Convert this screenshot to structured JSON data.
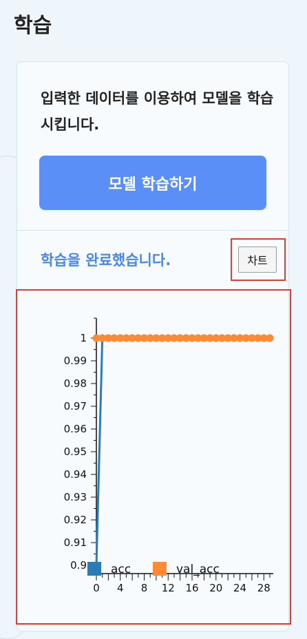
{
  "page": {
    "title": "학습"
  },
  "panel": {
    "description": "입력한 데이터를 이용하여 모델을 학습시킵니다.",
    "train_button_label": "모델 학습하기",
    "status": "학습을 완료했습니다.",
    "chart_button_label": "차트"
  },
  "colors": {
    "accent": "#5b8ff8",
    "status": "#4a86e8",
    "highlight": "#e53a2f",
    "acc": "#2b7bb9",
    "val_acc": "#ff8a33"
  },
  "chart_data": {
    "type": "line",
    "x": [
      0,
      1,
      2,
      3,
      4,
      5,
      6,
      7,
      8,
      9,
      10,
      11,
      12,
      13,
      14,
      15,
      16,
      17,
      18,
      19,
      20,
      21,
      22,
      23,
      24,
      25,
      26,
      27,
      28,
      29
    ],
    "xticks": [
      0,
      4,
      8,
      12,
      16,
      20,
      24,
      28
    ],
    "yticks": [
      0.9,
      0.91,
      0.92,
      0.93,
      0.94,
      0.95,
      0.96,
      0.97,
      0.98,
      0.99,
      1
    ],
    "ylim": [
      0.9,
      1.0
    ],
    "xlim": [
      0,
      29
    ],
    "series": [
      {
        "name": "acc",
        "values": [
          0.9,
          1,
          1,
          1,
          1,
          1,
          1,
          1,
          1,
          1,
          1,
          1,
          1,
          1,
          1,
          1,
          1,
          1,
          1,
          1,
          1,
          1,
          1,
          1,
          1,
          1,
          1,
          1,
          1,
          1
        ]
      },
      {
        "name": "val_acc",
        "values": [
          1,
          1,
          1,
          1,
          1,
          1,
          1,
          1,
          1,
          1,
          1,
          1,
          1,
          1,
          1,
          1,
          1,
          1,
          1,
          1,
          1,
          1,
          1,
          1,
          1,
          1,
          1,
          1,
          1,
          1
        ]
      }
    ],
    "legend_position": "bottom"
  }
}
